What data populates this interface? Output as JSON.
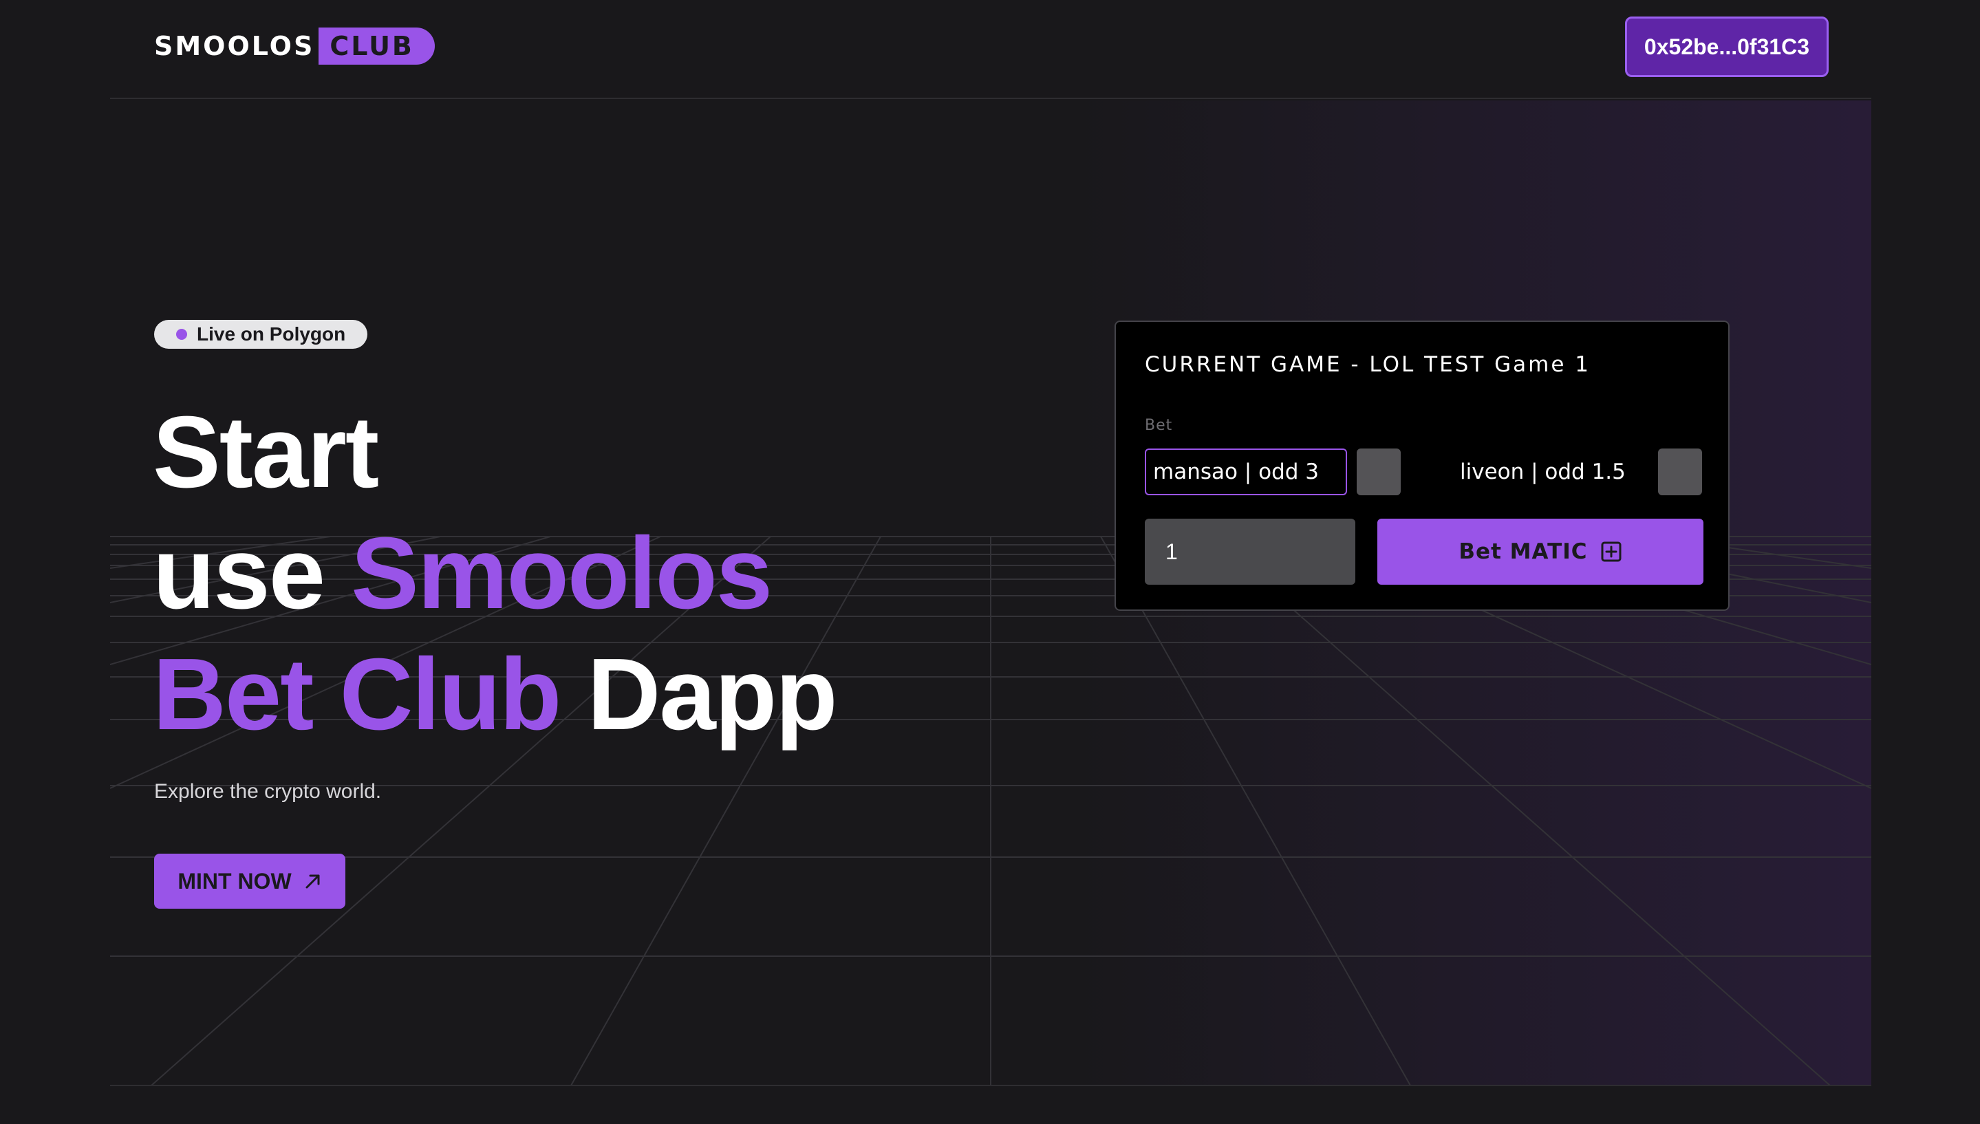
{
  "header": {
    "logo_main": "SMOOLOS",
    "logo_pill": "CLUB",
    "wallet_address": "0x52be...0f31C3"
  },
  "hero": {
    "badge": "Live on Polygon",
    "headline": {
      "line1": "Start",
      "line2_plain": "use ",
      "line2_accent": "Smoolos",
      "line3_accent": "Bet Club",
      "line3_plain": " Dapp"
    },
    "subtext": "Explore the crypto world.",
    "mint_button": "MINT NOW"
  },
  "game_card": {
    "title": "CURRENT GAME - LOL TEST Game 1",
    "bet_label": "Bet",
    "option_a": "mansao | odd 3",
    "option_b": "liveon | odd 1.5",
    "amount_value": "1",
    "bet_button": "Bet MATIC"
  },
  "icons": {
    "mint_arrow": "arrow-up-right-icon",
    "bet_plus": "plus-square-icon"
  },
  "colors": {
    "accent": "#9954e8",
    "wallet_bg": "#5f25a7",
    "background": "#19181b"
  }
}
